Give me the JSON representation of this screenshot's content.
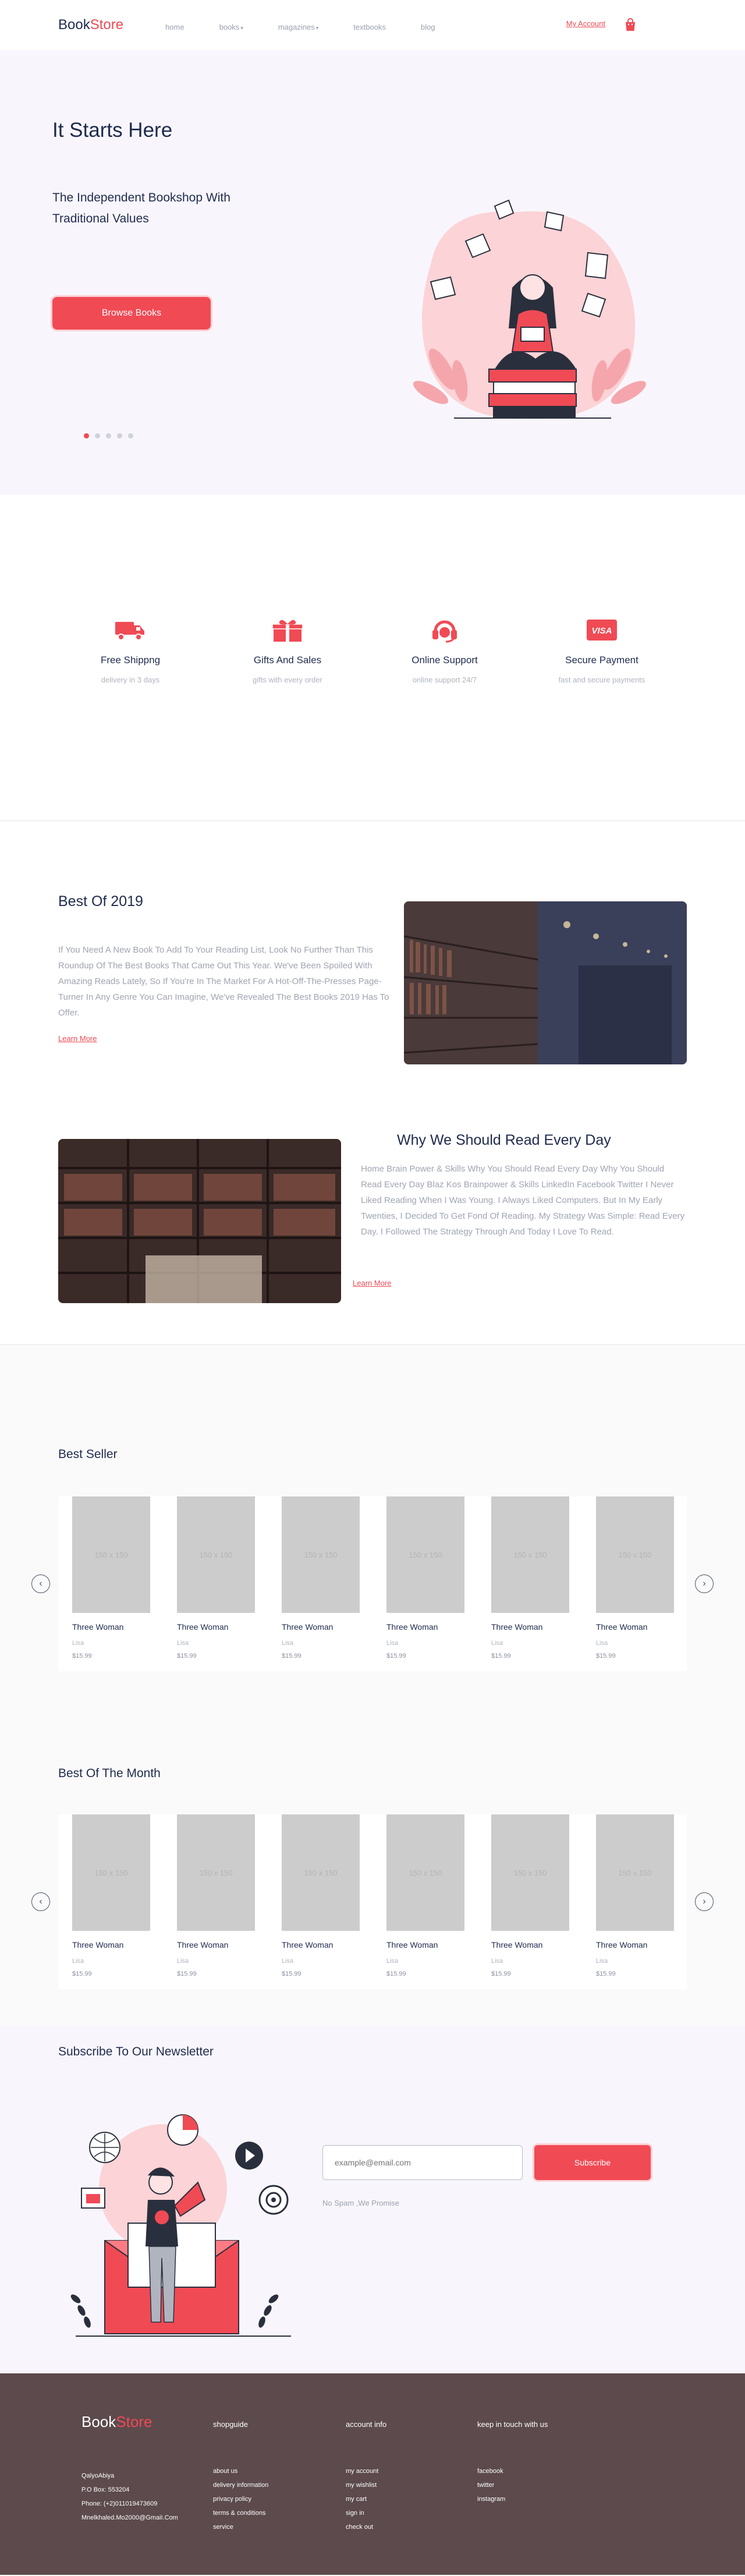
{
  "header": {
    "logo_main": "Book",
    "logo_accent": "Store",
    "nav": [
      "home",
      "books",
      "magazines",
      "textbooks",
      "blog"
    ],
    "nav_has_caret": [
      false,
      true,
      true,
      false,
      false
    ],
    "account": "My Account"
  },
  "hero": {
    "title": "It Starts Here",
    "subtitle": "The Independent Bookshop With Traditional Values",
    "button": "Browse Books",
    "slides": 5,
    "active_slide": 1
  },
  "features": [
    {
      "icon": "truck-icon",
      "title": "Free Shippng",
      "sub": "delivery in 3 days"
    },
    {
      "icon": "gift-icon",
      "title": "Gifts And Sales",
      "sub": "gifts with every order"
    },
    {
      "icon": "headset-icon",
      "title": "Online Support",
      "sub": "online support 24/7"
    },
    {
      "icon": "visa-card-icon",
      "title": "Secure Payment",
      "sub": "fast and secure payments"
    }
  ],
  "articles": [
    {
      "title": "Best Of 2019",
      "body": "If You Need A New Book To Add To Your Reading List, Look No Further Than This Roundup Of The Best Books That Came Out This Year. We've Been Spoiled With Amazing Reads Lately, So If You're In The Market For A Hot-Off-The-Presses Page-Turner In Any Genre You Can Imagine, We've Revealed The Best Books 2019 Has To Offer.",
      "more": "Learn More"
    },
    {
      "title": "Why We Should Read Every Day",
      "body": "Home Brain Power & Skills Why You Should Read Every Day Why You Should Read Every Day Blaz Kos Brainpower & Skills LinkedIn Facebook Twitter I Never Liked Reading When I Was Young. I Always Liked Computers. But In My Early Twenties, I Decided To Get Fond Of Reading. My Strategy Was Simple: Read Every Day. I Followed The Strategy Through And Today I Love To Read.",
      "more": "Learn More"
    }
  ],
  "best_seller": {
    "title": "Best Seller",
    "books": [
      {
        "placeholder": "150 x 150",
        "title": "Three Woman",
        "author": "Lisa",
        "price": "$15.99"
      },
      {
        "placeholder": "150 x 150",
        "title": "Three Woman",
        "author": "Lisa",
        "price": "$15.99"
      },
      {
        "placeholder": "150 x 150",
        "title": "Three Woman",
        "author": "Lisa",
        "price": "$15.99"
      },
      {
        "placeholder": "150 x 150",
        "title": "Three Woman",
        "author": "Lisa",
        "price": "$15.99"
      },
      {
        "placeholder": "150 x 150",
        "title": "Three Woman",
        "author": "Lisa",
        "price": "$15.99"
      },
      {
        "placeholder": "150 x 150",
        "title": "Three Woman",
        "author": "Lisa",
        "price": "$15.99"
      }
    ]
  },
  "best_month": {
    "title": "Best Of The Month",
    "books": [
      {
        "placeholder": "150 x 150",
        "title": "Three Woman",
        "author": "Lisa",
        "price": "$15.99"
      },
      {
        "placeholder": "150 x 150",
        "title": "Three Woman",
        "author": "Lisa",
        "price": "$15.99"
      },
      {
        "placeholder": "150 x 150",
        "title": "Three Woman",
        "author": "Lisa",
        "price": "$15.99"
      },
      {
        "placeholder": "150 x 150",
        "title": "Three Woman",
        "author": "Lisa",
        "price": "$15.99"
      },
      {
        "placeholder": "150 x 150",
        "title": "Three Woman",
        "author": "Lisa",
        "price": "$15.99"
      },
      {
        "placeholder": "150 x 150",
        "title": "Three Woman",
        "author": "Lisa",
        "price": "$15.99"
      }
    ]
  },
  "newsletter": {
    "title": "Subscribe To Our Newsletter",
    "placeholder": "example@email.com",
    "button": "Subscribe",
    "note": "No Spam ,We Promise"
  },
  "footer": {
    "logo_main": "Book",
    "logo_accent": "Store",
    "address": [
      "QalyoAbiya",
      "P.O Box: 553204",
      "Phone: (+2)01101947360​9",
      "Mnelkhaled.Mo2000@GmaiI.Com"
    ],
    "columns": [
      {
        "title": "shopguide",
        "links": [
          "about us",
          "delivery information",
          "privacy policy",
          "terms & conditions",
          "service"
        ]
      },
      {
        "title": "account info",
        "links": [
          "my account",
          "my wishlist",
          "my cart",
          "sign in",
          "check out"
        ]
      },
      {
        "title": "keep in touch with us",
        "links": [
          "facebook",
          "twitter",
          "instagram"
        ]
      }
    ]
  },
  "colors": {
    "accent": "#f04a55",
    "navy": "#1f2b4d",
    "footer": "#5c4a4d",
    "hero_bg": "#f8f6fc"
  }
}
